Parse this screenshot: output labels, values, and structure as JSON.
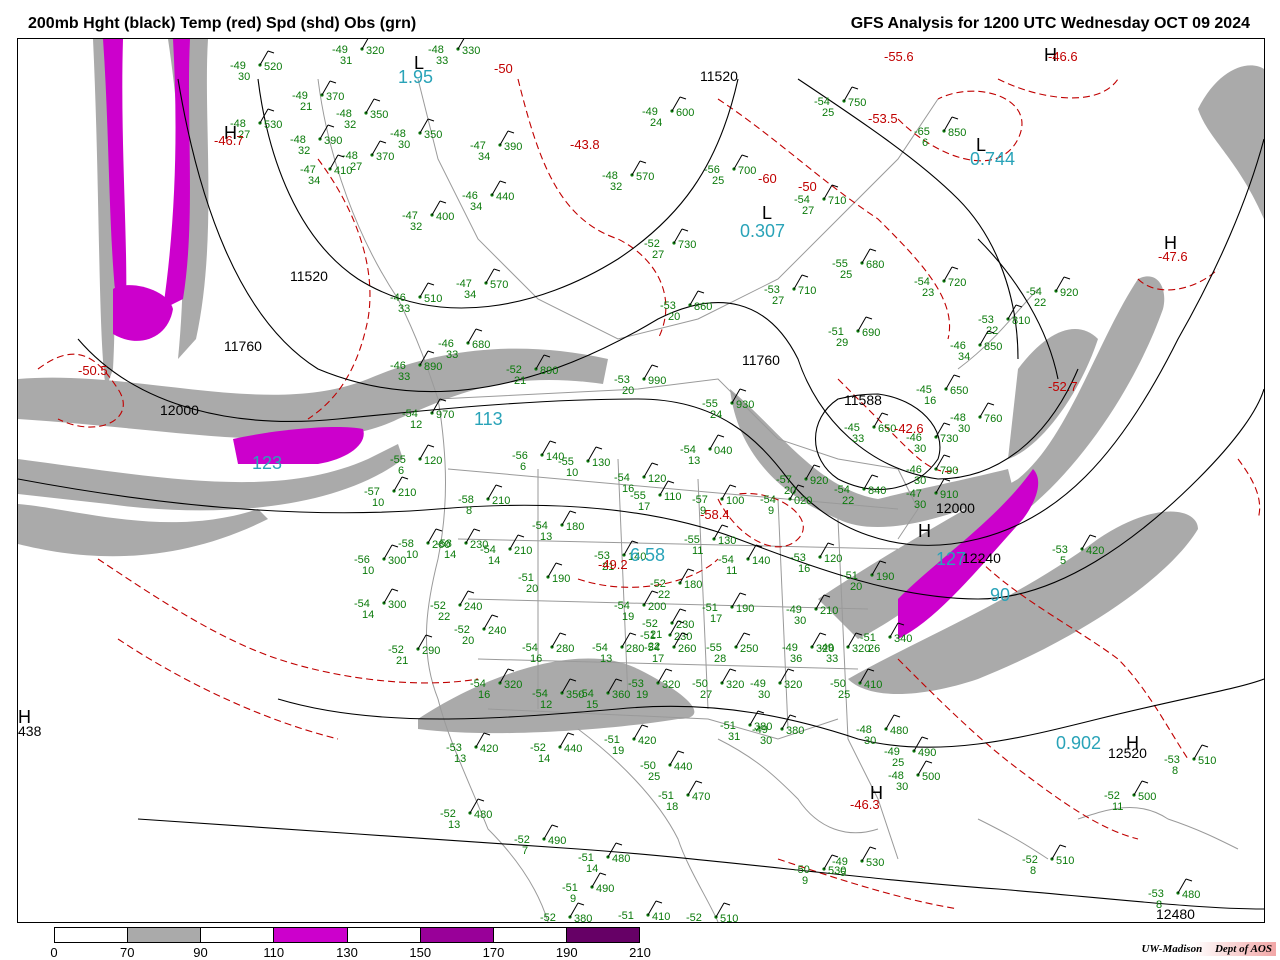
{
  "header": {
    "left_title": "200mb Hght (black) Temp (red) Spd (shd) Obs (grn)",
    "right_title": "GFS Analysis for 1200 UTC Wednesday  OCT 09 2024"
  },
  "colors": {
    "height_contour": "#000000",
    "temp_contour": "#c00000",
    "obs_text": "#0a7a0a",
    "center_value": "#29a3b8",
    "borders": "#9a9a9a"
  },
  "colorbar": {
    "labels": [
      "0",
      "70",
      "90",
      "110",
      "130",
      "150",
      "170",
      "190",
      "210"
    ],
    "colors": [
      "#ffffff",
      "#aaaaaa",
      "#ffffff",
      "#cc00cc",
      "#ffffff",
      "#990099",
      "#ffffff",
      "#660066"
    ]
  },
  "height_labels": [
    {
      "text": "11520"
    },
    {
      "text": "11760"
    },
    {
      "text": "12000"
    },
    {
      "text": "11520"
    },
    {
      "text": "11760"
    },
    {
      "text": "11588"
    },
    {
      "text": "12000"
    },
    {
      "text": "12240"
    },
    {
      "text": "12520"
    },
    {
      "text": "12480"
    },
    {
      "text": "438"
    }
  ],
  "pressure_centers": [
    {
      "letter": "H",
      "color": "#c00000"
    },
    {
      "letter": "H",
      "color": "#c00000"
    },
    {
      "letter": "H",
      "color": "#c00000"
    },
    {
      "letter": "H",
      "color": "#c00000"
    },
    {
      "letter": "H",
      "color": "#c00000"
    },
    {
      "letter": "H",
      "color": "#000000"
    },
    {
      "letter": "H",
      "color": "#000000"
    },
    {
      "letter": "L",
      "color": "#29a3b8"
    },
    {
      "letter": "L",
      "color": "#29a3b8"
    },
    {
      "letter": "L",
      "color": "#29a3b8"
    }
  ],
  "temp_labels": [
    {
      "text": "-50.5"
    },
    {
      "text": "-46.7"
    },
    {
      "text": "-43.8"
    },
    {
      "text": "-50"
    },
    {
      "text": "-53.5"
    },
    {
      "text": "-55.6"
    },
    {
      "text": "-46.6"
    },
    {
      "text": "-47.6"
    },
    {
      "text": "-52.7"
    },
    {
      "text": "-42.6"
    },
    {
      "text": "-58.4"
    },
    {
      "text": "-49.2"
    },
    {
      "text": "-46.3"
    },
    {
      "text": "-60"
    },
    {
      "text": "-50"
    }
  ],
  "speed_labels": [
    {
      "text": "1.95"
    },
    {
      "text": "0.744"
    },
    {
      "text": "0.307"
    },
    {
      "text": "113"
    },
    {
      "text": "123"
    },
    {
      "text": "6.58"
    },
    {
      "text": "127"
    },
    {
      "text": "90"
    },
    {
      "text": "0.902"
    }
  ],
  "observations": [
    {
      "t": "-49",
      "h": "520",
      "d": "30"
    },
    {
      "t": "-49",
      "h": "320",
      "d": "31"
    },
    {
      "t": "-48",
      "h": "330",
      "d": "33"
    },
    {
      "t": "-49",
      "h": "370",
      "d": "21"
    },
    {
      "t": "-48",
      "h": "530",
      "d": "27"
    },
    {
      "t": "-48",
      "h": "350",
      "d": "32"
    },
    {
      "t": "-48",
      "h": "390",
      "d": "32"
    },
    {
      "t": "-48",
      "h": "350",
      "d": "30"
    },
    {
      "t": "-48",
      "h": "370",
      "d": "27"
    },
    {
      "t": "-47",
      "h": "410",
      "d": "34"
    },
    {
      "t": "-47",
      "h": "390",
      "d": "34"
    },
    {
      "t": "-46",
      "h": "440",
      "d": "34"
    },
    {
      "t": "-47",
      "h": "400",
      "d": "32"
    },
    {
      "t": "-48",
      "h": "570",
      "d": "32"
    },
    {
      "t": "-49",
      "h": "600",
      "d": "24"
    },
    {
      "t": "-56",
      "h": "700",
      "d": "25"
    },
    {
      "t": "-54",
      "h": "750",
      "d": "25"
    },
    {
      "t": "-65",
      "h": "850",
      "d": "6"
    },
    {
      "t": "-54",
      "h": "710",
      "d": "27"
    },
    {
      "t": "-52",
      "h": "730",
      "d": "27"
    },
    {
      "t": "-47",
      "h": "570",
      "d": "34"
    },
    {
      "t": "-46",
      "h": "510",
      "d": "33"
    },
    {
      "t": "-55",
      "h": "680",
      "d": "25"
    },
    {
      "t": "-54",
      "h": "720",
      "d": "23"
    },
    {
      "t": "-54",
      "h": "920",
      "d": "22"
    },
    {
      "t": "-53",
      "h": "710",
      "d": "27"
    },
    {
      "t": "-53",
      "h": "860",
      "d": "20"
    },
    {
      "t": "-53",
      "h": "810",
      "d": "22"
    },
    {
      "t": "-46",
      "h": "680",
      "d": "33"
    },
    {
      "t": "-51",
      "h": "690",
      "d": "29"
    },
    {
      "t": "-46",
      "h": "850",
      "d": "34"
    },
    {
      "t": "-46",
      "h": "890",
      "d": "33"
    },
    {
      "t": "-52",
      "h": "890",
      "d": "21"
    },
    {
      "t": "-53",
      "h": "990",
      "d": "20"
    },
    {
      "t": "-55",
      "h": "930",
      "d": "24"
    },
    {
      "t": "-45",
      "h": "650",
      "d": "16"
    },
    {
      "t": "-48",
      "h": "760",
      "d": "30"
    },
    {
      "t": "-54",
      "h": "970",
      "d": "12"
    },
    {
      "t": "-55",
      "h": "120",
      "d": "6"
    },
    {
      "t": "-56",
      "h": "140",
      "d": "6"
    },
    {
      "t": "-55",
      "h": "130",
      "d": "10"
    },
    {
      "t": "-54",
      "h": "040",
      "d": "13"
    },
    {
      "t": "-45",
      "h": "650",
      "d": "33"
    },
    {
      "t": "-46",
      "h": "730",
      "d": "30"
    },
    {
      "t": "-46",
      "h": "790",
      "d": "30"
    },
    {
      "t": "-57",
      "h": "210",
      "d": "10"
    },
    {
      "t": "-58",
      "h": "210",
      "d": "8"
    },
    {
      "t": "-54",
      "h": "120",
      "d": "16"
    },
    {
      "t": "-55",
      "h": "110",
      "d": "17"
    },
    {
      "t": "-57",
      "h": "100",
      "d": "9"
    },
    {
      "t": "-54",
      "h": "020",
      "d": "9"
    },
    {
      "t": "-57",
      "h": "920",
      "d": "20"
    },
    {
      "t": "-54",
      "h": "840",
      "d": "22"
    },
    {
      "t": "-47",
      "h": "910",
      "d": "30"
    },
    {
      "t": "-54",
      "h": "180",
      "d": "13"
    },
    {
      "t": "-58",
      "h": "260",
      "d": "10"
    },
    {
      "t": "-58",
      "h": "230",
      "d": "14"
    },
    {
      "t": "-54",
      "h": "210",
      "d": "14"
    },
    {
      "t": "-55",
      "h": "130",
      "d": "11"
    },
    {
      "t": "-54",
      "h": "140",
      "d": "11"
    },
    {
      "t": "-53",
      "h": "120",
      "d": "16"
    },
    {
      "t": "-53",
      "h": "140",
      "d": "21"
    },
    {
      "t": "-56",
      "h": "300",
      "d": "10"
    },
    {
      "t": "-51",
      "h": "190",
      "d": "20"
    },
    {
      "t": "-52",
      "h": "180",
      "d": "22"
    },
    {
      "t": "-51",
      "h": "190",
      "d": "17"
    },
    {
      "t": "-51",
      "h": "190",
      "d": "20"
    },
    {
      "t": "-53",
      "h": "420",
      "d": "5"
    },
    {
      "t": "-54",
      "h": "300",
      "d": "14"
    },
    {
      "t": "-52",
      "h": "240",
      "d": "22"
    },
    {
      "t": "-52",
      "h": "240",
      "d": "20"
    },
    {
      "t": "-54",
      "h": "200",
      "d": "19"
    },
    {
      "t": "-52",
      "h": "230",
      "d": "21"
    },
    {
      "t": "-49",
      "h": "210",
      "d": "30"
    },
    {
      "t": "-51",
      "h": "230",
      "d": "22"
    },
    {
      "t": "-51",
      "h": "340",
      "d": "26"
    },
    {
      "t": "-52",
      "h": "290",
      "d": "21"
    },
    {
      "t": "-54",
      "h": "280",
      "d": "16"
    },
    {
      "t": "-54",
      "h": "280",
      "d": "13"
    },
    {
      "t": "-54",
      "h": "260",
      "d": "17"
    },
    {
      "t": "-55",
      "h": "250",
      "d": "28"
    },
    {
      "t": "-49",
      "h": "320",
      "d": "36"
    },
    {
      "t": "-49",
      "h": "320",
      "d": "33"
    },
    {
      "t": "-54",
      "h": "320",
      "d": "16"
    },
    {
      "t": "-54",
      "h": "350",
      "d": "12"
    },
    {
      "t": "-54",
      "h": "360",
      "d": "15"
    },
    {
      "t": "-53",
      "h": "320",
      "d": "19"
    },
    {
      "t": "-50",
      "h": "320",
      "d": "27"
    },
    {
      "t": "-49",
      "h": "320",
      "d": "30"
    },
    {
      "t": "-50",
      "h": "410",
      "d": "25"
    },
    {
      "t": "-53",
      "h": "420",
      "d": "13"
    },
    {
      "t": "-52",
      "h": "440",
      "d": "14"
    },
    {
      "t": "-51",
      "h": "420",
      "d": "19"
    },
    {
      "t": "-51",
      "h": "380",
      "d": "31"
    },
    {
      "t": "-49",
      "h": "380",
      "d": "30"
    },
    {
      "t": "-48",
      "h": "480",
      "d": "30"
    },
    {
      "t": "-49",
      "h": "490",
      "d": "25"
    },
    {
      "t": "-50",
      "h": "440",
      "d": "25"
    },
    {
      "t": "-48",
      "h": "500",
      "d": "30"
    },
    {
      "t": "-53",
      "h": "510",
      "d": "8"
    },
    {
      "t": "-52",
      "h": "480",
      "d": "13"
    },
    {
      "t": "-51",
      "h": "470",
      "d": "18"
    },
    {
      "t": "-52",
      "h": "500",
      "d": "11"
    },
    {
      "t": "-52",
      "h": "490",
      "d": "7"
    },
    {
      "t": "-51",
      "h": "480",
      "d": "14"
    },
    {
      "t": "-50",
      "h": "530",
      "d": "9"
    },
    {
      "t": "-49",
      "h": "530",
      "d": "5"
    },
    {
      "t": "-52",
      "h": "510",
      "d": "8"
    },
    {
      "t": "-51",
      "h": "490",
      "d": "9"
    },
    {
      "t": "-51",
      "h": "410",
      "d": ""
    },
    {
      "t": "-52",
      "h": "510",
      "d": ""
    },
    {
      "t": "-52",
      "h": "380",
      "d": ""
    },
    {
      "t": "-53",
      "h": "480",
      "d": "8"
    }
  ],
  "credit": {
    "org": "UW-Madison",
    "dept": "Dept of AOS"
  }
}
